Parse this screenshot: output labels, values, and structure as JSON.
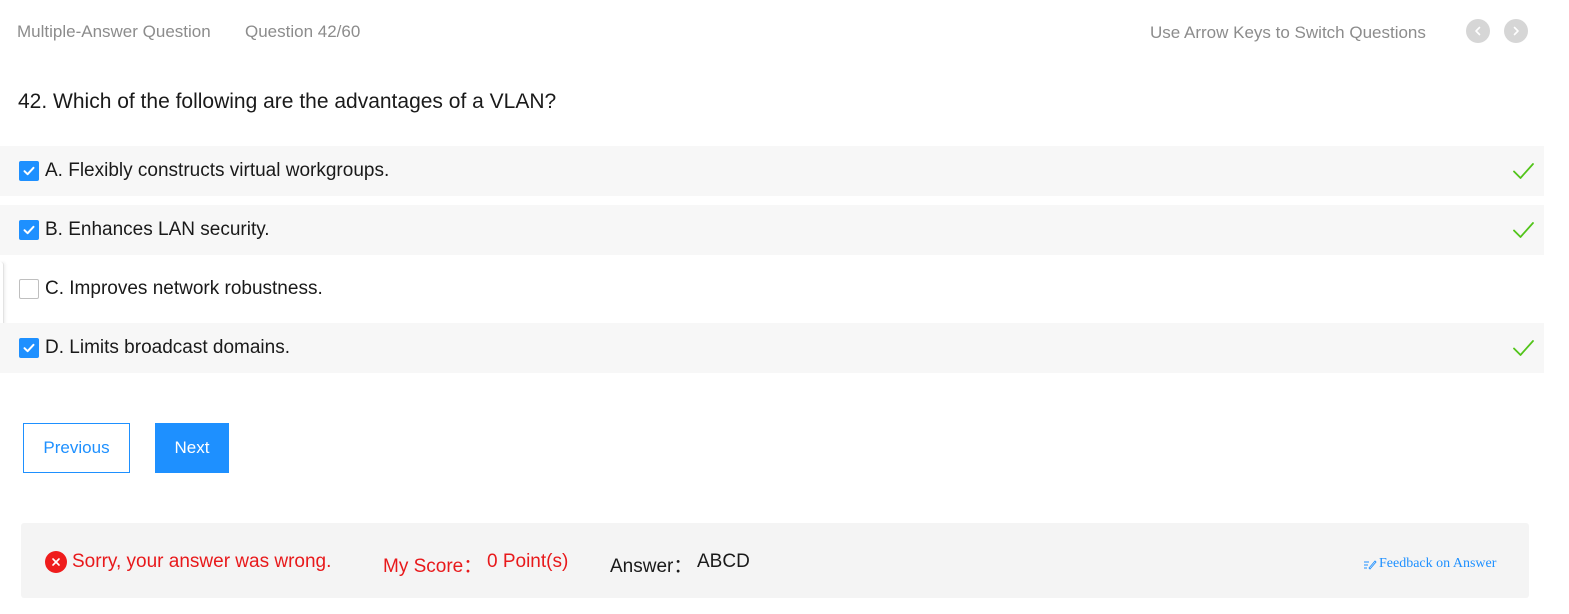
{
  "header": {
    "question_type": "Multiple-Answer Question",
    "question_counter": "Question 42/60",
    "hint": "Use Arrow Keys to Switch Questions"
  },
  "question": {
    "text": "42. Which of the following are the advantages of a VLAN?"
  },
  "options": [
    {
      "label": "A. Flexibly constructs virtual workgroups.",
      "checked": true,
      "correct": true
    },
    {
      "label": "B. Enhances LAN security.",
      "checked": true,
      "correct": true
    },
    {
      "label": "C. Improves network robustness.",
      "checked": false,
      "correct": false
    },
    {
      "label": "D. Limits broadcast domains.",
      "checked": true,
      "correct": true
    }
  ],
  "buttons": {
    "previous": "Previous",
    "next": "Next"
  },
  "result": {
    "message": "Sorry, your answer was wrong.",
    "score_label": "My Score：",
    "score_value": "0 Point(s)",
    "answer_label": "Answer：",
    "answer_value": "ABCD",
    "feedback_link": "Feedback on Answer"
  },
  "colors": {
    "accent": "#1e90ff",
    "error": "#e8191b",
    "correct_tick": "#52c41a"
  },
  "icons": {
    "prev_nav": "chevron-left-icon",
    "next_nav": "chevron-right-icon",
    "checkbox": "checkmark-icon",
    "correct": "correct-tick-icon",
    "wrong": "close-circle-icon",
    "feedback": "edit-icon"
  }
}
